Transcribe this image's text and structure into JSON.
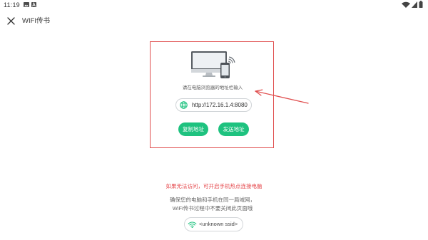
{
  "status_bar": {
    "time": "11:19",
    "left_icons": [
      "gallery-icon",
      "a-notification-icon"
    ],
    "right_icons": [
      "wifi-status-icon",
      "signal-icon",
      "battery-icon"
    ]
  },
  "toolbar": {
    "title": "WIFI传书",
    "close_icon": "close-icon"
  },
  "transfer_card": {
    "illustration": "computer-phone-illustration",
    "instruction": "请在电脑浏览器的地址栏输入",
    "url_icon": "globe-icon",
    "url": "http://172.16.1.4:8080",
    "copy_button_label": "复制地址",
    "send_button_label": "发送地址"
  },
  "help": {
    "warning": "如果无法访问，可开启手机热点连接电脑",
    "hint_line_1": "确保您的电脑和手机在同一局域网，",
    "hint_line_2": "WiFi传书过程中不要关闭此页面哦",
    "ssid_icon": "wifi-icon",
    "ssid": "<unknown ssid>"
  },
  "colors": {
    "accent": "#1ec27f",
    "warning_text": "#e5474b",
    "annotation": "#e04f4f",
    "hint_text": "#666666"
  }
}
